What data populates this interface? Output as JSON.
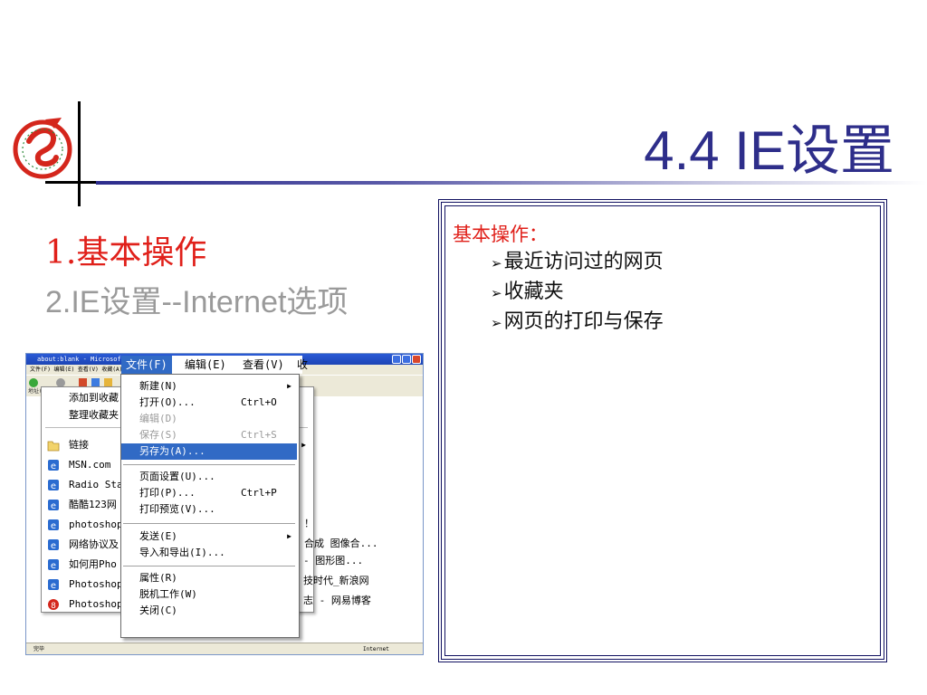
{
  "slide": {
    "title": "4.4 IE设置",
    "items": [
      "1.基本操作",
      "2.IE设置--Internet选项"
    ]
  },
  "box": {
    "heading": "基本操作：",
    "bullets": [
      "最近访问过的网页",
      "收藏夹",
      "网页的打印与保存"
    ]
  },
  "browser": {
    "title": "about:blank - Microsoft Inte",
    "menubar": "文件(F)  编辑(E)  查看(V)  收藏(A)",
    "address": "地址(D)",
    "status_left": "完毕",
    "status_right": "Internet",
    "file_menu_bar": {
      "title": "文件(F)",
      "edit": "编辑(E)",
      "view": "查看(V)",
      "fav_partial": "收"
    },
    "favorites": {
      "top": [
        "添加到收藏",
        "整理收藏夹"
      ],
      "links_folder": "链接",
      "entries": [
        "MSN.com",
        "Radio Sta",
        "酷酷123网",
        "photoshop",
        "网络协议及",
        "如何用Pho",
        "Photoshop",
        "Photoshop"
      ],
      "right_fragments": [
        "合成 图像合...",
        "- 图形图...",
        "技时代_新浪网",
        "志 - 网易博客"
      ],
      "bang": "！"
    },
    "file_menu": [
      {
        "label": "新建(N)",
        "shortcut": "",
        "submenu": true,
        "disabled": false
      },
      {
        "label": "打开(O)...",
        "shortcut": "Ctrl+O",
        "submenu": false,
        "disabled": false
      },
      {
        "label": "编辑(D)",
        "shortcut": "",
        "submenu": false,
        "disabled": true
      },
      {
        "label": "保存(S)",
        "shortcut": "Ctrl+S",
        "submenu": false,
        "disabled": true
      },
      {
        "label": "另存为(A)...",
        "shortcut": "",
        "submenu": false,
        "disabled": false,
        "selected": true
      },
      {
        "label": "页面设置(U)...",
        "shortcut": "",
        "submenu": false,
        "disabled": false
      },
      {
        "label": "打印(P)...",
        "shortcut": "Ctrl+P",
        "submenu": false,
        "disabled": false
      },
      {
        "label": "打印预览(V)...",
        "shortcut": "",
        "submenu": false,
        "disabled": false
      },
      {
        "label": "发送(E)",
        "shortcut": "",
        "submenu": true,
        "disabled": false
      },
      {
        "label": "导入和导出(I)...",
        "shortcut": "",
        "submenu": false,
        "disabled": false
      },
      {
        "label": "属性(R)",
        "shortcut": "",
        "submenu": false,
        "disabled": false
      },
      {
        "label": "脱机工作(W)",
        "shortcut": "",
        "submenu": false,
        "disabled": false
      },
      {
        "label": "关闭(C)",
        "shortcut": "",
        "submenu": false,
        "disabled": false
      }
    ]
  },
  "colors": {
    "title": "#2e2e8a",
    "red": "#e0201a",
    "gray": "#9a9a9a",
    "menu_highlight": "#316ac5"
  }
}
